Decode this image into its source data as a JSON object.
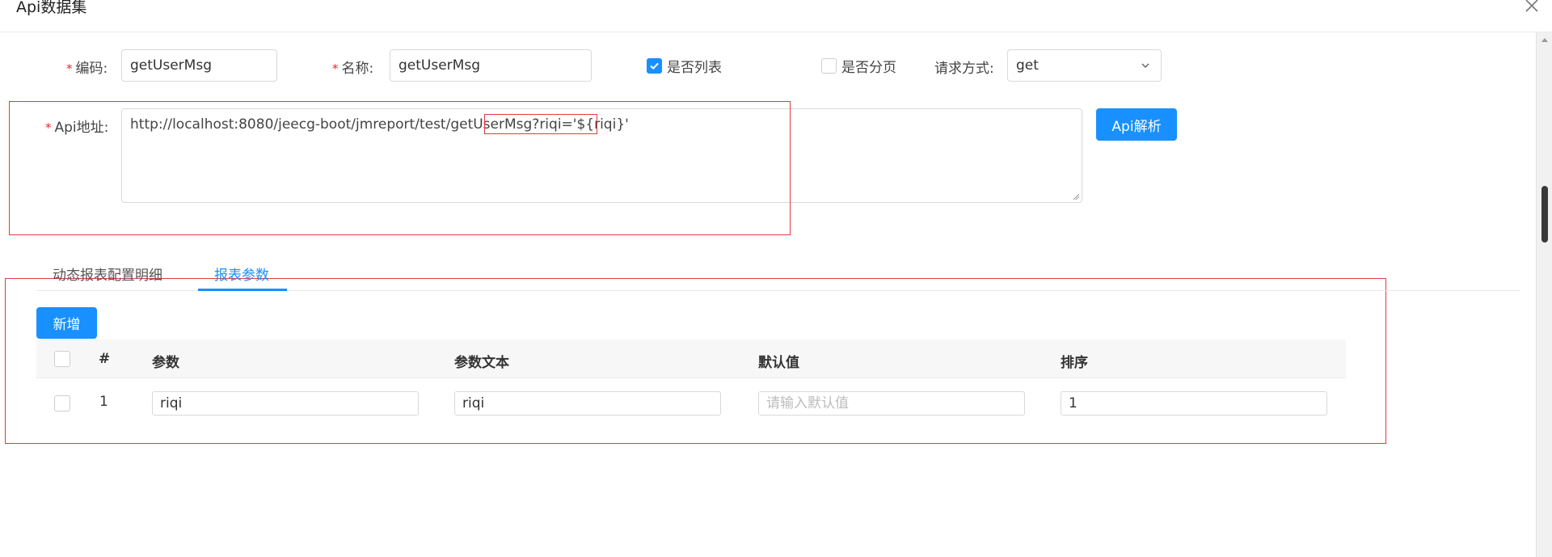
{
  "dialog": {
    "title": "Api数据集"
  },
  "form": {
    "code": {
      "label": "编码:",
      "value": "getUserMsg"
    },
    "name": {
      "label": "名称:",
      "value": "getUserMsg"
    },
    "is_list": {
      "label": "是否列表",
      "checked": true
    },
    "is_paged": {
      "label": "是否分页",
      "checked": false
    },
    "request_method": {
      "label": "请求方式:",
      "value": "get"
    },
    "api_url": {
      "label": "Api地址:",
      "value": "http://localhost:8080/jeecg-boot/jmreport/test/getUserMsg?riqi='${riqi}'"
    },
    "parse_button": "Api解析",
    "required_mark": "*"
  },
  "tabs": [
    {
      "label": "动态报表配置明细",
      "active": false
    },
    {
      "label": "报表参数",
      "active": true
    }
  ],
  "params": {
    "add_button": "新增",
    "columns": [
      "#",
      "参数",
      "参数文本",
      "默认值",
      "排序"
    ],
    "rows": [
      {
        "index": "1",
        "param": "riqi",
        "param_text": "riqi",
        "default_placeholder": "请输入默认值",
        "order": "1"
      }
    ]
  },
  "colors": {
    "primary": "#1890ff",
    "required": "#f5222d",
    "highlight": "#e6393f"
  }
}
